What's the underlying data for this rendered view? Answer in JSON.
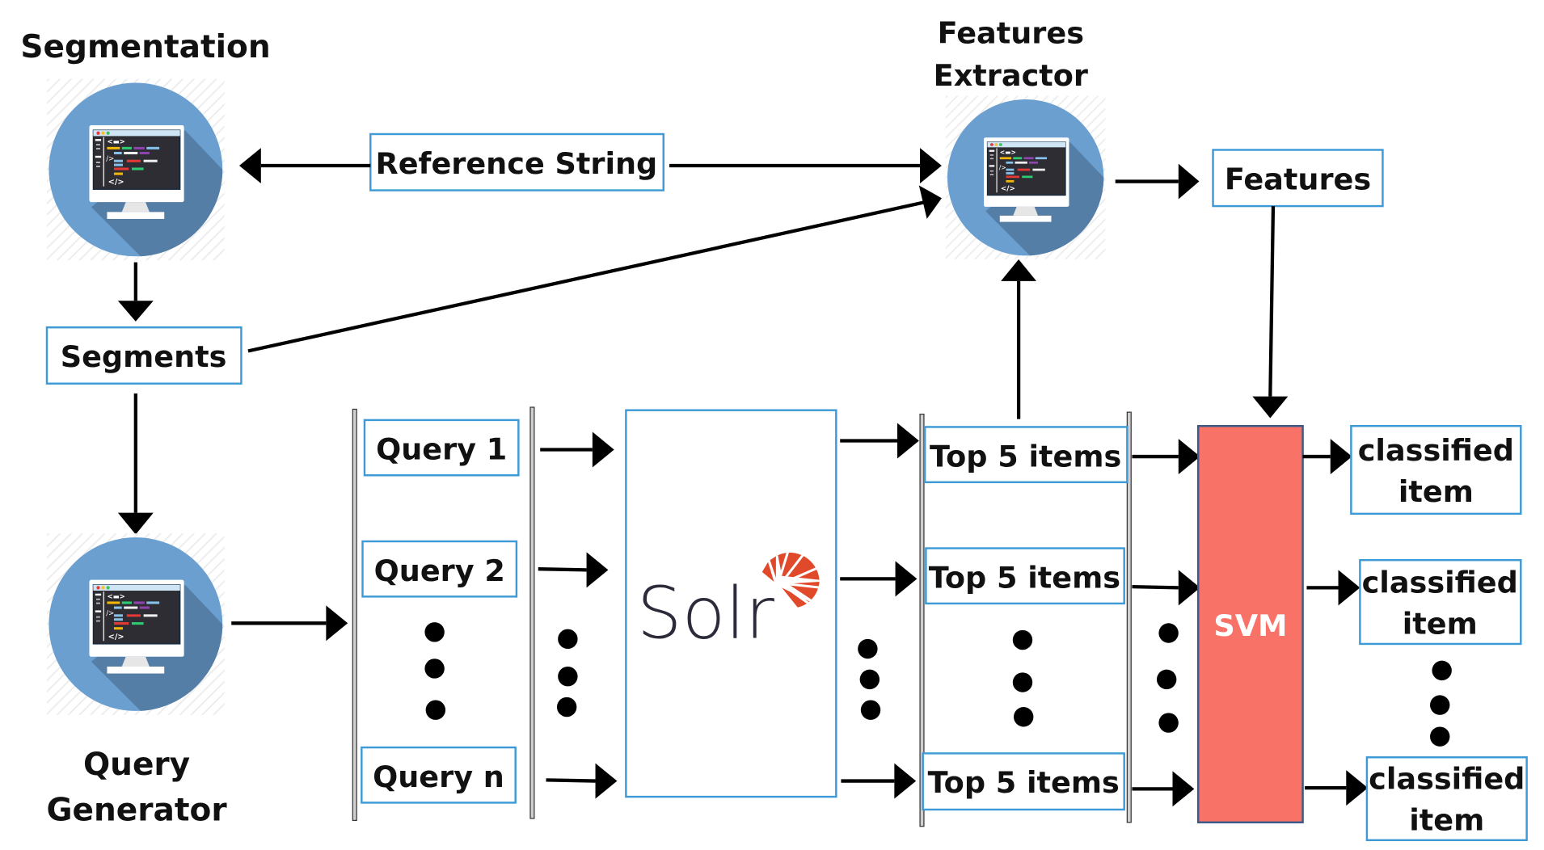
{
  "diagram": {
    "title_segmentation": "Segmentation",
    "title_features_extractor_line1": "Features",
    "title_features_extractor_line2": "Extractor",
    "title_query_generator_line1": "Query",
    "title_query_generator_line2": "Generator",
    "reference_string": "Reference String",
    "features": "Features",
    "segments": "Segments",
    "queries": [
      "Query 1",
      "Query 2",
      "Query n"
    ],
    "solr_label": "Solr",
    "top_items": [
      "Top 5 items",
      "Top 5 items",
      "Top 5 items"
    ],
    "svm_label": "SVM",
    "classified": [
      {
        "line1": "classified",
        "line2": "item"
      },
      {
        "line1": "classified",
        "line2": "item"
      },
      {
        "line1": "classified",
        "line2": "item"
      }
    ],
    "module_icon": "computer-code-icon",
    "colors": {
      "box_border": "#3d9ad6",
      "svm_fill": "#f87268",
      "svm_border": "#3a5a8a",
      "svm_text": "#ffffff",
      "solr_text": "#2b2b3a",
      "solr_sun": "#e04a2a",
      "icon_circle": "#6a9fd0",
      "icon_shadow": "#557ea6"
    }
  }
}
